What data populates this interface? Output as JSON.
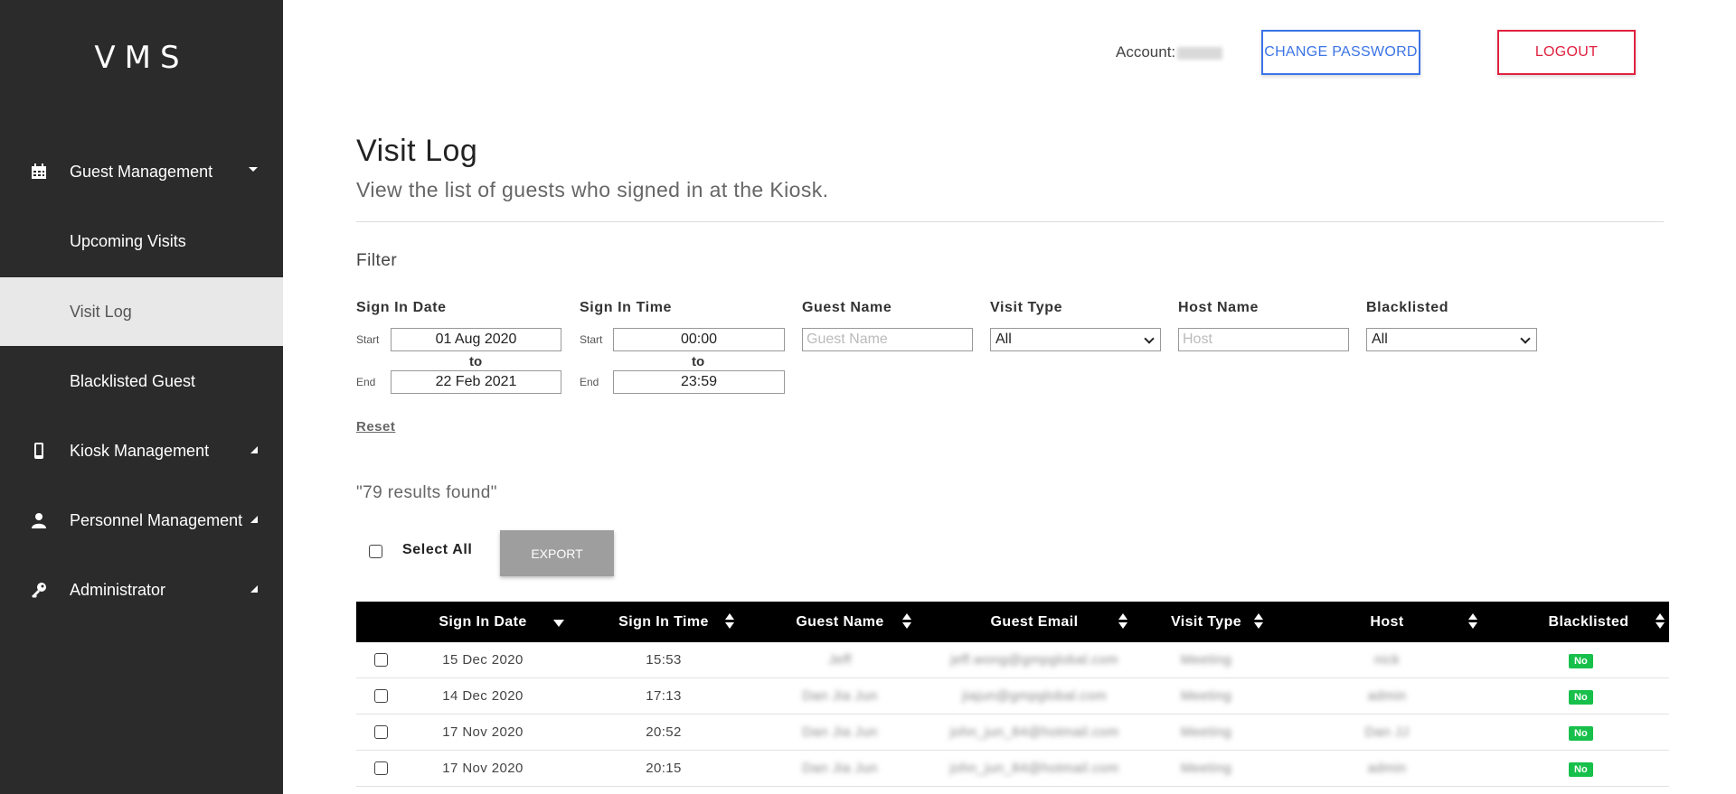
{
  "app": {
    "brand": "VMS"
  },
  "sidebar": {
    "items": [
      {
        "label": "Guest Management"
      },
      {
        "label": "Upcoming Visits"
      },
      {
        "label": "Visit Log"
      },
      {
        "label": "Blacklisted Guest"
      },
      {
        "label": "Kiosk Management"
      },
      {
        "label": "Personnel Management"
      },
      {
        "label": "Administrator"
      }
    ]
  },
  "header": {
    "account_label": "Account:",
    "change_password": "CHANGE PASSWORD",
    "logout": "LOGOUT"
  },
  "page": {
    "title": "Visit Log",
    "subtitle": "View the list of guests who signed in at the Kiosk."
  },
  "filter": {
    "title": "Filter",
    "sign_in_date": {
      "label": "Sign In Date",
      "start_label": "Start",
      "start": "01 Aug 2020",
      "to": "to",
      "end_label": "End",
      "end": "22 Feb 2021"
    },
    "sign_in_time": {
      "label": "Sign In Time",
      "start_label": "Start",
      "start": "00:00",
      "to": "to",
      "end_label": "End",
      "end": "23:59"
    },
    "guest_name": {
      "label": "Guest Name",
      "placeholder": "Guest Name"
    },
    "visit_type": {
      "label": "Visit Type",
      "value": "All"
    },
    "host_name": {
      "label": "Host Name",
      "placeholder": "Host"
    },
    "blacklisted": {
      "label": "Blacklisted",
      "value": "All"
    },
    "reset": "Reset"
  },
  "results": {
    "text": "\"79 results found\""
  },
  "actions": {
    "select_all": "Select All",
    "export": "EXPORT"
  },
  "table": {
    "headers": [
      "Sign In Date",
      "Sign In Time",
      "Guest Name",
      "Guest Email",
      "Visit Type",
      "Host",
      "Blacklisted"
    ],
    "rows": [
      {
        "date": "15 Dec 2020",
        "time": "15:53",
        "name": "Jeff",
        "email": "jeff.wong@gmpglobal.com",
        "type": "Meeting",
        "host": "nick",
        "blacklisted": "No"
      },
      {
        "date": "14 Dec 2020",
        "time": "17:13",
        "name": "Dan Jia Jun",
        "email": "jiajun@gmpglobal.com",
        "type": "Meeting",
        "host": "admin",
        "blacklisted": "No"
      },
      {
        "date": "17 Nov 2020",
        "time": "20:52",
        "name": "Dan Jia Jun",
        "email": "john_jun_84@hotmail.com",
        "type": "Meeting",
        "host": "Dan JJ",
        "blacklisted": "No"
      },
      {
        "date": "17 Nov 2020",
        "time": "20:15",
        "name": "Dan Jia Jun",
        "email": "john_jun_84@hotmail.com",
        "type": "Meeting",
        "host": "admin",
        "blacklisted": "No"
      }
    ]
  }
}
